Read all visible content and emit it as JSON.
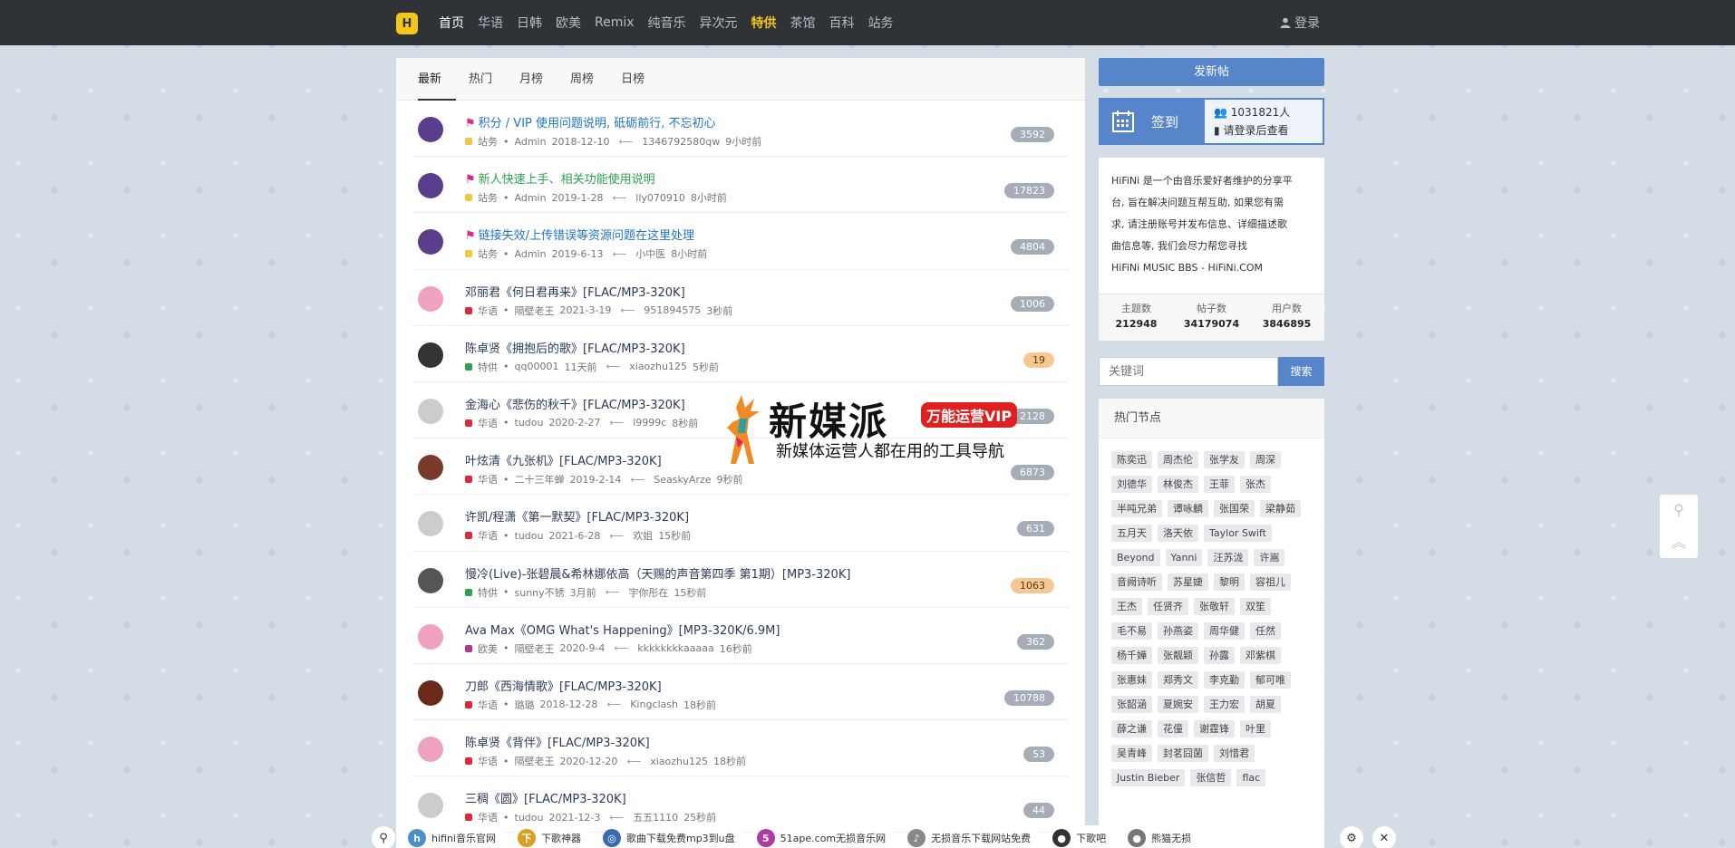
{
  "navbar": {
    "logo_text": "H",
    "items": [
      {
        "label": "首页",
        "state": "active"
      },
      {
        "label": "华语",
        "state": ""
      },
      {
        "label": "日韩",
        "state": ""
      },
      {
        "label": "欧美",
        "state": ""
      },
      {
        "label": "Remix",
        "state": ""
      },
      {
        "label": "纯音乐",
        "state": ""
      },
      {
        "label": "异次元",
        "state": ""
      },
      {
        "label": "特供",
        "state": "special"
      },
      {
        "label": "茶馆",
        "state": ""
      },
      {
        "label": "百科",
        "state": ""
      },
      {
        "label": "站务",
        "state": ""
      }
    ],
    "login_label": "登录"
  },
  "tabs": [
    "最新",
    "热门",
    "月榜",
    "周榜",
    "日榜"
  ],
  "threads": [
    {
      "title": "积分 / VIP 使用问题说明, 砥砺前行, 不忘初心",
      "style": "blue",
      "flag": true,
      "forum": "站务",
      "dot": "#f2c744",
      "author": "Admin",
      "date": "2018-12-10",
      "reply_user": "1346792580qw",
      "reply_time": "9小时前",
      "count": "3592",
      "avatar": "#5a3d8c",
      "hot": false
    },
    {
      "title": "新人快速上手、相关功能使用说明",
      "style": "green",
      "flag": true,
      "forum": "站务",
      "dot": "#f2c744",
      "author": "Admin",
      "date": "2019-1-28",
      "reply_user": "lly070910",
      "reply_time": "8小时前",
      "count": "17823",
      "avatar": "#5a3d8c",
      "hot": false
    },
    {
      "title": "链接失效/上传错误等资源问题在这里处理",
      "style": "blue",
      "flag": true,
      "forum": "站务",
      "dot": "#f2c744",
      "author": "Admin",
      "date": "2019-6-13",
      "reply_user": "小中医",
      "reply_time": "8小时前",
      "count": "4804",
      "avatar": "#5a3d8c",
      "hot": false
    },
    {
      "title": "邓丽君《何日君再来》[FLAC/MP3-320K]",
      "style": "",
      "flag": false,
      "forum": "华语",
      "dot": "#e0283a",
      "author": "隔壁老王",
      "date": "2021-3-19",
      "reply_user": "951894575",
      "reply_time": "3秒前",
      "count": "1006",
      "avatar": "#f0a0c0",
      "hot": false
    },
    {
      "title": "陈卓贤《拥抱后的歌》[FLAC/MP3-320K]",
      "style": "",
      "flag": false,
      "forum": "特供",
      "dot": "#2aa34a",
      "author": "qq00001",
      "date": "11天前",
      "reply_user": "xiaozhu125",
      "reply_time": "5秒前",
      "count": "19",
      "avatar": "#333333",
      "hot": true
    },
    {
      "title": "金海心《悲伤的秋千》[FLAC/MP3-320K]",
      "style": "",
      "flag": false,
      "forum": "华语",
      "dot": "#e0283a",
      "author": "tudou",
      "date": "2020-2-27",
      "reply_user": "l9999c",
      "reply_time": "8秒前",
      "count": "2128",
      "avatar": "#cccccc",
      "hot": false
    },
    {
      "title": "叶炫清《九张机》[FLAC/MP3-320K]",
      "style": "",
      "flag": false,
      "forum": "华语",
      "dot": "#e0283a",
      "author": "二十三年蝉",
      "date": "2019-2-14",
      "reply_user": "SeaskyArze",
      "reply_time": "9秒前",
      "count": "6873",
      "avatar": "#7a3a2a",
      "hot": false
    },
    {
      "title": "许凯/程潇《第一默契》[FLAC/MP3-320K]",
      "style": "",
      "flag": false,
      "forum": "华语",
      "dot": "#e0283a",
      "author": "tudou",
      "date": "2021-6-28",
      "reply_user": "欢姐",
      "reply_time": "15秒前",
      "count": "631",
      "avatar": "#cccccc",
      "hot": false
    },
    {
      "title": "慢冷(Live)-张碧晨&希林娜依高（天赐的声音第四季 第1期）[MP3-320K]",
      "style": "",
      "flag": false,
      "forum": "特供",
      "dot": "#2aa34a",
      "author": "sunny不锈",
      "date": "3月前",
      "reply_user": "宇你彤在",
      "reply_time": "15秒前",
      "count": "1063",
      "avatar": "#555555",
      "hot": true
    },
    {
      "title": "Ava Max《OMG What's Happening》[MP3-320K/6.9M]",
      "style": "",
      "flag": false,
      "forum": "欧美",
      "dot": "#b03a8c",
      "author": "隔壁老王",
      "date": "2020-9-4",
      "reply_user": "kkkkkkkkaaaaa",
      "reply_time": "16秒前",
      "count": "362",
      "avatar": "#f0a0c0",
      "hot": false
    },
    {
      "title": "刀郎《西海情歌》[FLAC/MP3-320K]",
      "style": "",
      "flag": false,
      "forum": "华语",
      "dot": "#e0283a",
      "author": "璐璐",
      "date": "2018-12-28",
      "reply_user": "Kingclash",
      "reply_time": "18秒前",
      "count": "10788",
      "avatar": "#6a2a1a",
      "hot": false
    },
    {
      "title": "陈卓贤《背伴》[FLAC/MP3-320K]",
      "style": "",
      "flag": false,
      "forum": "华语",
      "dot": "#e0283a",
      "author": "隔壁老王",
      "date": "2020-12-20",
      "reply_user": "xiaozhu125",
      "reply_time": "18秒前",
      "count": "53",
      "avatar": "#f0a0c0",
      "hot": false
    },
    {
      "title": "三稠《圆》[FLAC/MP3-320K]",
      "style": "",
      "flag": false,
      "forum": "华语",
      "dot": "#e0283a",
      "author": "tudou",
      "date": "2021-12-3",
      "reply_user": "五五1110",
      "reply_time": "25秒前",
      "count": "44",
      "avatar": "#cccccc",
      "hot": false
    }
  ],
  "sidebar": {
    "post_button": "发新帖",
    "checkin_label": "签到",
    "checkin_count": "1031821人",
    "checkin_login": "请登录后查看",
    "intro_lines": [
      "HiFiNi 是一个由音乐爱好者维护的分享平",
      "台, 旨在解决问题互帮互助, 如果您有需",
      "求, 请注册账号并发布信息、详细描述歌",
      "曲信息等, 我们会尽力帮您寻找",
      "HiFiNi MUSIC BBS - HiFiNi.COM"
    ],
    "stats": [
      {
        "label": "主题数",
        "value": "212948"
      },
      {
        "label": "帖子数",
        "value": "34179074"
      },
      {
        "label": "用户数",
        "value": "3846895"
      }
    ],
    "search_placeholder": "关键词",
    "search_button": "搜索",
    "hot_nodes_title": "热门节点",
    "tags": [
      "陈奕迅",
      "周杰伦",
      "张学友",
      "周深",
      "刘德华",
      "林俊杰",
      "王菲",
      "张杰",
      "半吨兄弟",
      "谭咏麟",
      "张国荣",
      "梁静茹",
      "五月天",
      "洛天依",
      "Taylor Swift",
      "Beyond",
      "Yanni",
      "汪苏泷",
      "许嵩",
      "音阙诗听",
      "苏星婕",
      "黎明",
      "容祖儿",
      "王杰",
      "任贤齐",
      "张敬轩",
      "双笙",
      "毛不易",
      "孙燕姿",
      "周华健",
      "任然",
      "杨千嬅",
      "张靓颖",
      "孙露",
      "邓紫棋",
      "张惠妹",
      "郑秀文",
      "李克勤",
      "郁可唯",
      "张韶涵",
      "夏婉安",
      "王力宏",
      "胡夏",
      "薛之谦",
      "花僮",
      "谢霆锋",
      "叶里",
      "吴青峰",
      "封茗囧菌",
      "刘惜君",
      "Justin Bieber",
      "张信哲",
      "flac"
    ]
  },
  "ad": {
    "title": "新媒派",
    "badge": "万能运营VIP",
    "subtitle": "新媒体运营人都在用的工具导航"
  },
  "bottom_bar": {
    "items": [
      {
        "label": "hifini音乐官网",
        "fav": "h",
        "color": "#4a90c8"
      },
      {
        "label": "下歌神器",
        "fav": "下",
        "color": "#d9a020"
      },
      {
        "label": "歌曲下载免费mp3到u盘",
        "fav": "◎",
        "color": "#3a6ab0"
      },
      {
        "label": "51ape.com无损音乐网",
        "fav": "5",
        "color": "#b03aa0"
      },
      {
        "label": "无损音乐下载网站免费",
        "fav": "♪",
        "color": "#888888"
      },
      {
        "label": "下歌吧",
        "fav": "●",
        "color": "#333333"
      },
      {
        "label": "熊猫无损",
        "fav": "●",
        "color": "#777777"
      }
    ]
  }
}
